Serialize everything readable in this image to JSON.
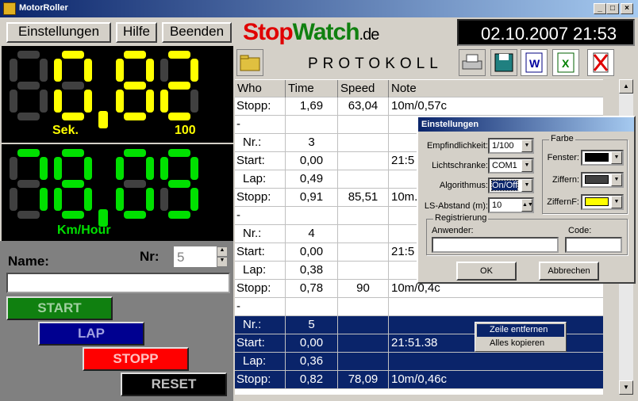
{
  "window": {
    "title": "MotorRoller",
    "min": "_",
    "max": "□",
    "close": "×"
  },
  "menu": {
    "settings": "Einstellungen",
    "help": "Hilfe",
    "quit": "Beenden"
  },
  "logo": {
    "part1": "Stop",
    "part2": "Watch",
    "part3": ".de"
  },
  "clock": {
    "date": "02.10.2007",
    "time": "21:53"
  },
  "timer": {
    "value": "00,82",
    "unit": "Sek.",
    "scale": "100",
    "color": "#ffff00"
  },
  "speed": {
    "value": "78,09",
    "unit": "Km/Hour",
    "color": "#00e000"
  },
  "name_label": "Name:",
  "nr_label": "Nr:",
  "nr_value": "5",
  "name_value": "",
  "buttons": {
    "start": "START",
    "lap": "LAP",
    "stopp": "STOPP",
    "reset": "RESET"
  },
  "protokoll": {
    "title": "PROTOKOLL"
  },
  "table": {
    "headers": [
      "Who",
      "Time",
      "Speed",
      "Note"
    ],
    "rows": [
      [
        "Stopp:",
        "1,69",
        "63,04",
        "10m/0,57c"
      ],
      [
        "-",
        "",
        "",
        ""
      ],
      [
        "Nr.:",
        "3",
        "",
        ""
      ],
      [
        "Start:",
        "0,00",
        "",
        "21:5"
      ],
      [
        "Lap:",
        "0,49",
        "",
        ""
      ],
      [
        "Stopp:",
        "0,91",
        "85,51",
        "10m."
      ],
      [
        "-",
        "",
        "",
        ""
      ],
      [
        "Nr.:",
        "4",
        "",
        ""
      ],
      [
        "Start:",
        "0,00",
        "",
        "21:5"
      ],
      [
        "Lap:",
        "0,38",
        "",
        ""
      ],
      [
        "Stopp:",
        "0,78",
        "90",
        "10m/0,4c"
      ],
      [
        "-",
        "",
        "",
        ""
      ],
      [
        "Nr.:",
        "5",
        "",
        ""
      ],
      [
        "Start:",
        "0,00",
        "",
        "21:51.38"
      ],
      [
        "Lap:",
        "0,36",
        "",
        ""
      ],
      [
        "Stopp:",
        "0,82",
        "78,09",
        "10m/0,46c"
      ]
    ]
  },
  "dialog": {
    "title": "Einstellungen",
    "sensitivity_label": "Empfindlichkeit:",
    "sensitivity_value": "1/100",
    "barrier_label": "Lichtschranke:",
    "barrier_value": "COM1",
    "algo_label": "Algorithmus:",
    "algo_value": "On/Off",
    "distance_label": "LS-Abstand (m):",
    "distance_value": "10",
    "color_group": "Farbe",
    "window_color_label": "Fenster:",
    "digits_color_label": "Ziffern:",
    "digitsf_color_label": "ZiffernF:",
    "window_color": "#000000",
    "digits_color": "#404040",
    "digitsf_color": "#ffff00",
    "reg_group": "Registrierung",
    "user_label": "Anwender:",
    "code_label": "Code:",
    "ok": "OK",
    "cancel": "Abbrechen"
  },
  "context_menu": {
    "remove_row": "Zeile entfernen",
    "copy_all": "Alles kopieren"
  }
}
